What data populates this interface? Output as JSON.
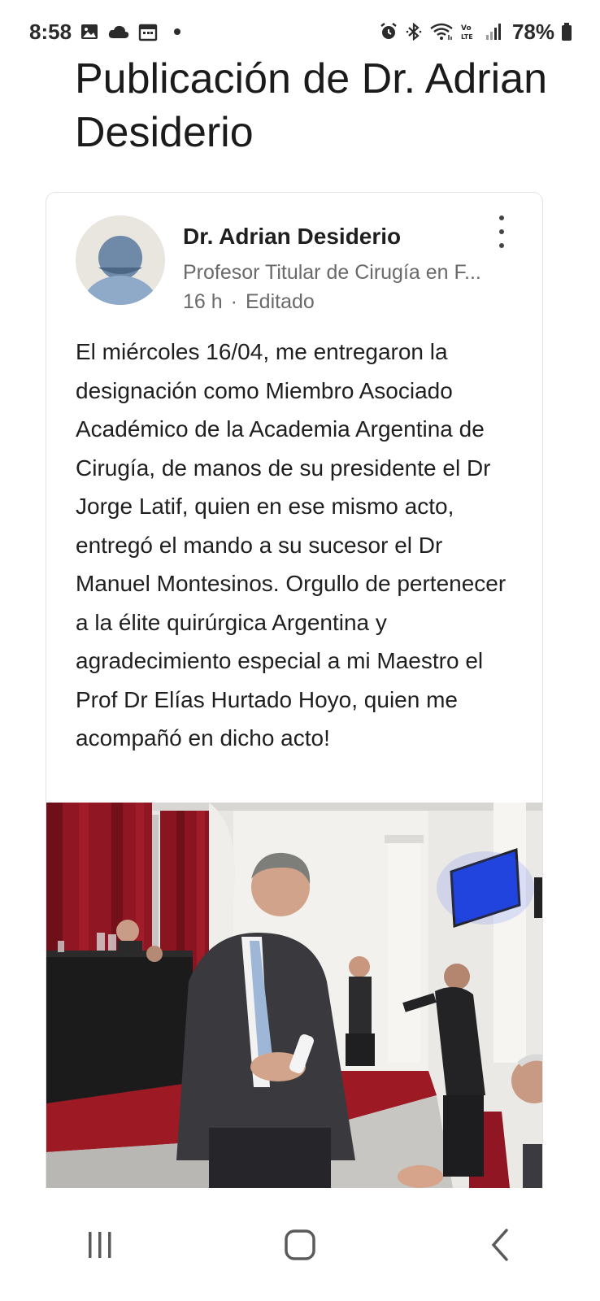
{
  "status_bar": {
    "time": "8:58",
    "battery": "78%",
    "icons_left": [
      "gallery-icon",
      "cloud-icon",
      "calendar-icon",
      "dot-icon"
    ],
    "icons_right": [
      "alarm-icon",
      "bluetooth-icon",
      "wifi-icon",
      "volte-icon",
      "signal-icon",
      "battery-icon"
    ]
  },
  "page": {
    "title": "Publicación de Dr. Adrian Desiderio"
  },
  "post": {
    "author_name": "Dr. Adrian Desiderio",
    "author_headline": "Profesor Titular de Cirugía en F...",
    "time_ago": "16 h",
    "separator": "·",
    "edited": "Editado",
    "text": "El miércoles 16/04, me entregaron la designación como Miembro Asociado Académico de la Academia Argentina de Cirugía, de manos de su presidente el Dr Jorge Latif, quien en ese mismo acto, entregó el mando a su sucesor el Dr Manuel Montesinos. Orgullo de pertenecer a la élite quirúrgica Argentina y agradecimiento especial a mi Maestro el Prof Dr Elías Hurtado Hoyo, quien me acompañó en dicho acto!"
  },
  "nav_bar": {
    "items": [
      "recent-apps-button",
      "home-button",
      "back-button"
    ]
  },
  "colors": {
    "text_primary": "#1f1f1f",
    "text_secondary": "#6a6a6a",
    "card_border": "#e3e3e3",
    "curtain_red": "#8f1622",
    "screen_blue": "#1d3fd9"
  }
}
